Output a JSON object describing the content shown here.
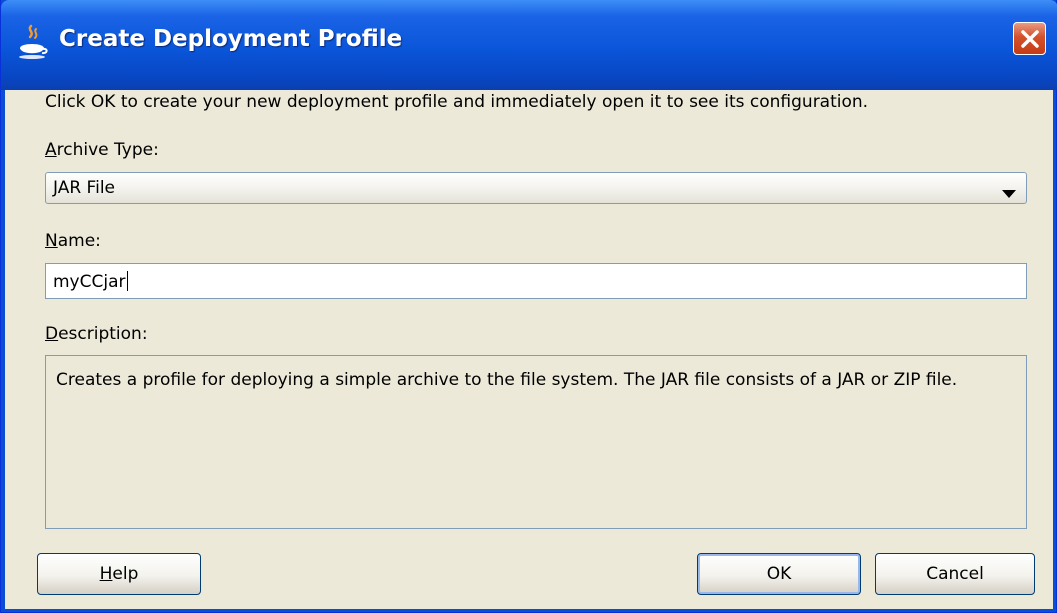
{
  "window": {
    "title": "Create Deployment Profile",
    "close_icon": "close-icon",
    "app_icon": "java-cup-icon"
  },
  "instruction": "Click OK to create your new deployment profile and immediately open it to see its configuration.",
  "archive_type": {
    "label_mnemonic": "A",
    "label_rest": "rchive Type:",
    "selected": "JAR File"
  },
  "name": {
    "label_mnemonic": "N",
    "label_rest": "ame:",
    "value": "myCCjar"
  },
  "description": {
    "label_mnemonic": "D",
    "label_rest": "escription:",
    "text": "Creates a profile for deploying a simple archive to the file system. The JAR file consists of a JAR or ZIP file."
  },
  "buttons": {
    "help_mnemonic": "H",
    "help_rest": "elp",
    "ok": "OK",
    "cancel": "Cancel"
  },
  "colors": {
    "titlebar": "#0a55d9",
    "client_bg": "#ece9d8",
    "close_button": "#d4512c"
  }
}
